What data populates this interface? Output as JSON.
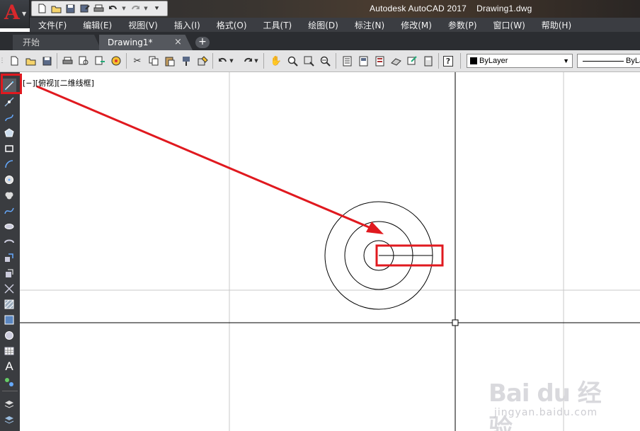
{
  "window": {
    "title": "Autodesk AutoCAD 2017    Drawing1.dwg",
    "app_logo": "A"
  },
  "quick_access": {
    "icons": [
      "new-icon",
      "open-icon",
      "save-icon",
      "saveas-icon",
      "print-icon",
      "undo-icon",
      "redo-icon",
      "customize-icon"
    ]
  },
  "menu": {
    "items": [
      "文件(F)",
      "编辑(E)",
      "视图(V)",
      "插入(I)",
      "格式(O)",
      "工具(T)",
      "绘图(D)",
      "标注(N)",
      "修改(M)",
      "参数(P)",
      "窗口(W)",
      "帮助(H)"
    ]
  },
  "tabs": {
    "start": "开始",
    "drawing": "Drawing1*",
    "close": "×",
    "add": "+"
  },
  "toolbar": {
    "layer_value": "ByLayer",
    "linetype_value": "ByLa",
    "help": "?"
  },
  "left_toolbar": {
    "tools": [
      "line-icon",
      "construction-line-icon",
      "polyline-icon",
      "polygon-icon",
      "rectangle-icon",
      "arc-icon",
      "circle-icon",
      "revision-cloud-icon",
      "spline-icon",
      "ellipse-icon",
      "ellipse-arc-icon",
      "insert-block-icon",
      "make-block-icon",
      "point-icon",
      "hatch-icon",
      "gradient-icon",
      "region-icon",
      "table-icon",
      "mtext-icon",
      "add-selected-icon"
    ],
    "highlighted": "line-icon",
    "text_tool": "A"
  },
  "canvas": {
    "viewport_label": "[−][俯视][二维线框]"
  },
  "annotations": {
    "highlight_color": "#e0191f",
    "arrow_color": "#e0191f"
  },
  "watermark": {
    "brand": "Bai du 经验",
    "url": "jingyan.baidu.com"
  }
}
